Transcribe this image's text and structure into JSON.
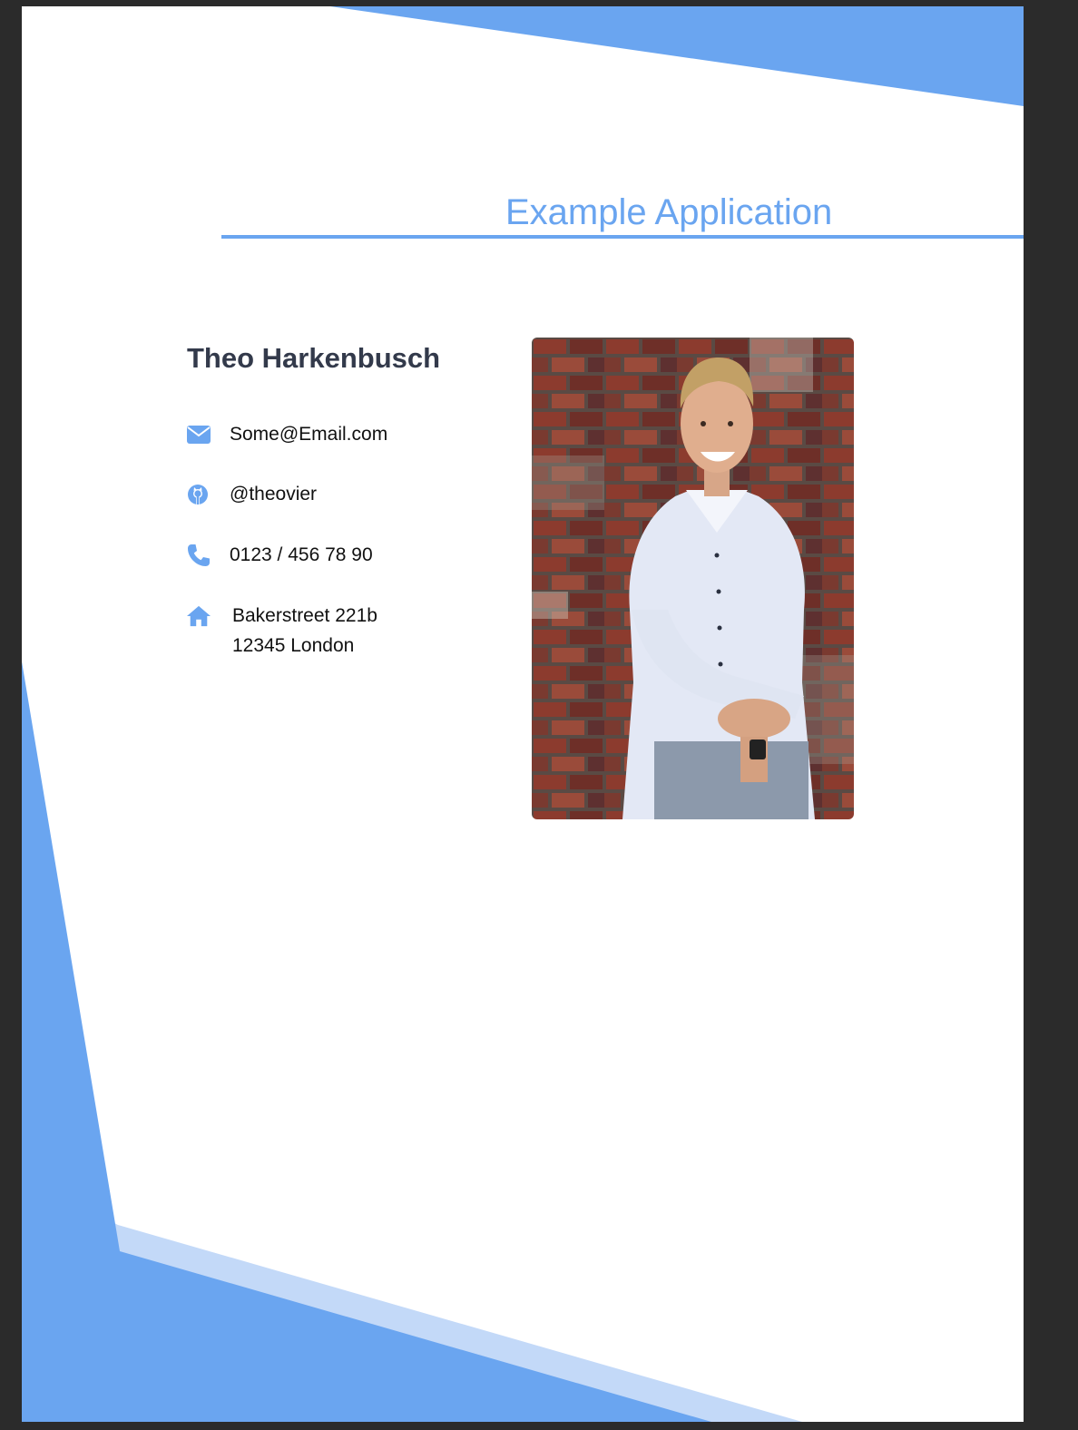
{
  "document": {
    "title": "Example Application"
  },
  "profile": {
    "name": "Theo Harkenbusch",
    "contacts": {
      "email": {
        "icon": "envelope-icon",
        "text": "Some@Email.com"
      },
      "github": {
        "icon": "github-icon",
        "text": "@theovier"
      },
      "phone": {
        "icon": "phone-icon",
        "text": "0123 / 456 78 90"
      },
      "address": {
        "icon": "home-icon",
        "line1": "Bakerstreet 221b",
        "line2": "12345 London"
      }
    }
  },
  "colors": {
    "accent": "#6aa5f0",
    "accent_light": "#c3d9f8",
    "name_text": "#333a4b",
    "viewer_background": "#2b2b2b"
  }
}
